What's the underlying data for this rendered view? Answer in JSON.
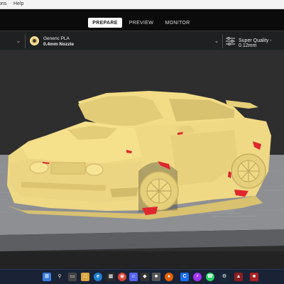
{
  "menu": {
    "items": [
      "ons",
      "Help"
    ]
  },
  "stages": {
    "prepare": "PREPARE",
    "preview": "PREVIEW",
    "monitor": "MONITOR",
    "active": "prepare"
  },
  "material": {
    "name": "Generic PLA",
    "nozzle": "0.4mm Nozzle"
  },
  "quality": {
    "label": "Super Quality - 0.12mm"
  },
  "colors": {
    "model": "#f2dc86",
    "overhang": "#e0262e",
    "plate": "#8f8f94",
    "viewport_bg": "#2e2e2e",
    "taskbar": "#1a2236",
    "accent": "#e9c86a"
  },
  "taskbar": {
    "icons": [
      "windows-start-icon",
      "search-icon",
      "task-view-icon",
      "file-explorer-icon",
      "edge-browser-icon",
      "store-icon",
      "chrome-icon",
      "discord-icon",
      "app-icon",
      "app-icon",
      "firefox-icon",
      "cura-icon",
      "messenger-icon",
      "whatsapp-icon",
      "steam-icon",
      "app-icon",
      "app-icon"
    ]
  }
}
